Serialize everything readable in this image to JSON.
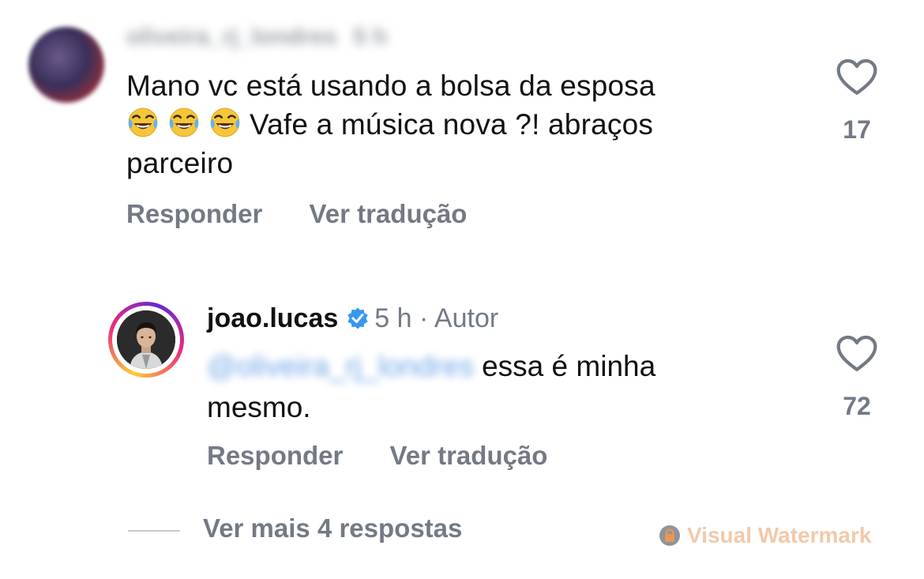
{
  "comment1": {
    "username": "oliveira_rj_londres",
    "time": "5 h",
    "text_line1": "Mano vc está usando a bolsa da esposa",
    "emojis": [
      "tears-of-joy-emoji",
      "tears-of-joy-emoji",
      "tears-of-joy-emoji"
    ],
    "text_line2_after_emoji": "Vafe a música nova ?! abraços",
    "text_line3": "parceiro",
    "reply_label": "Responder",
    "translate_label": "Ver tradução",
    "like_icon": "heart-outline-icon",
    "like_count": "17"
  },
  "comment2": {
    "username": "joao.lucas",
    "verified_icon": "verified-badge-icon",
    "time": "5 h",
    "separator": "·",
    "author_label": "Autor",
    "mention": "@oliveira_rj_londres",
    "text_after_mention": "essa é minha",
    "text_line2": "mesmo.",
    "reply_label": "Responder",
    "translate_label": "Ver tradução",
    "like_icon": "heart-outline-icon",
    "like_count": "72"
  },
  "view_more": {
    "label": "Ver mais 4 respostas"
  },
  "watermark": {
    "text": "Visual Watermark",
    "icon": "lock-icon"
  },
  "colors": {
    "secondary_text": "#737a84",
    "verified_blue": "#3897f0",
    "mention_blue": "#6fa7e6",
    "watermark": "#f1c7a6"
  }
}
